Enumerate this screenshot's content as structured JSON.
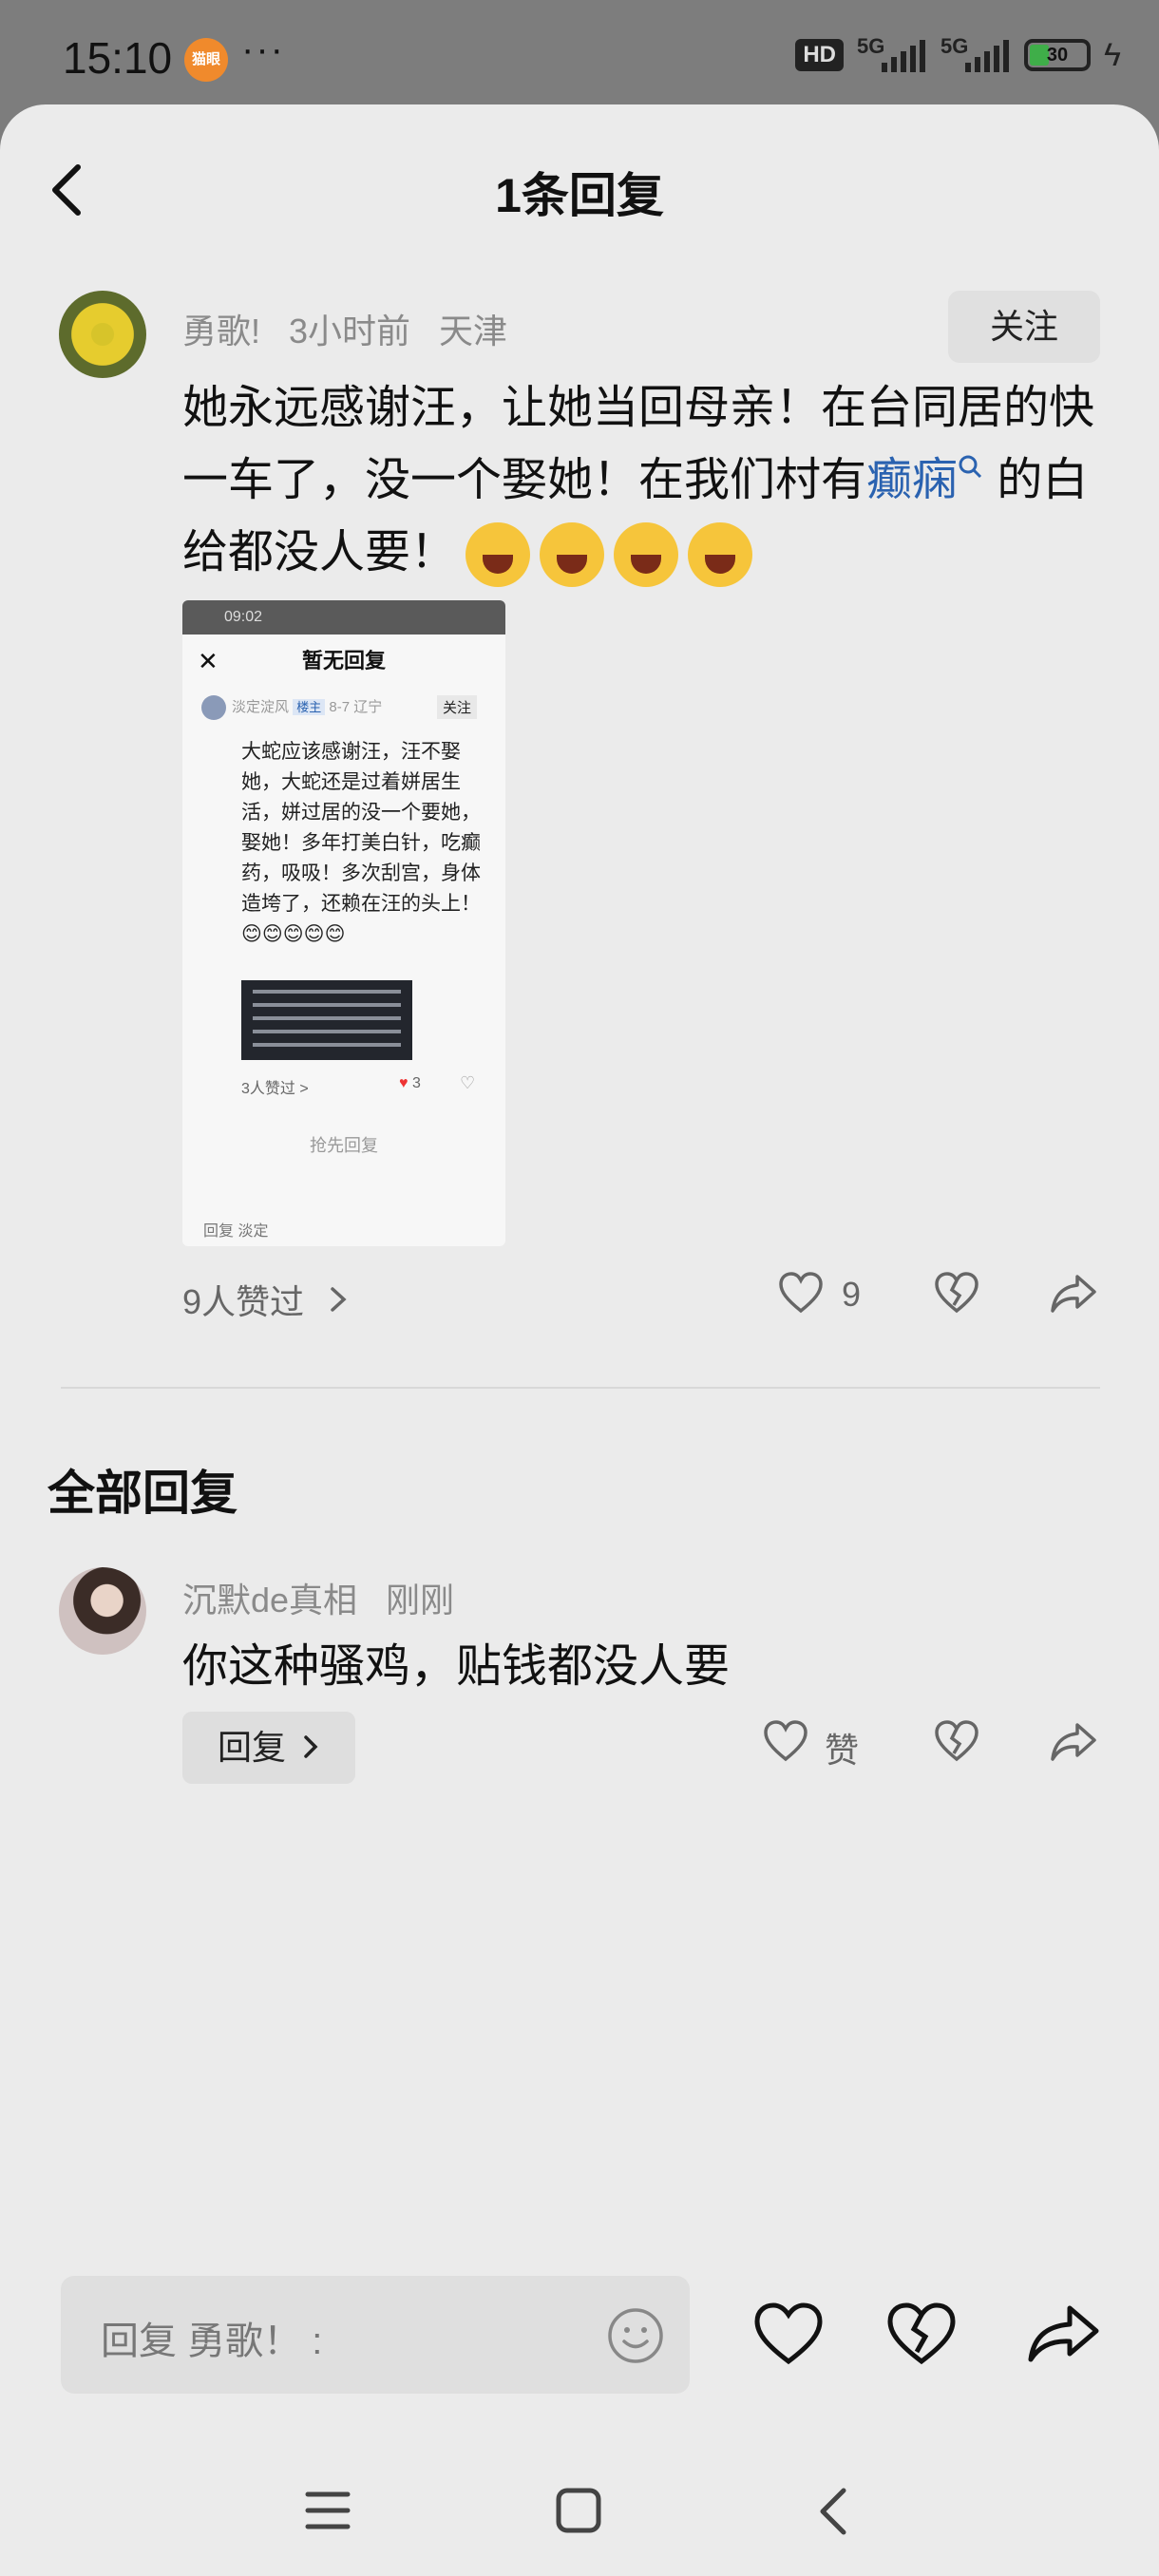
{
  "status_bar": {
    "time": "15:10",
    "app_badge": "猫眼",
    "dots": "···",
    "hd": "HD",
    "net1": "5G",
    "net2": "5G",
    "battery": "30"
  },
  "header": {
    "title": "1条回复"
  },
  "main_comment": {
    "author": "勇歌!",
    "time": "3小时前",
    "location": "天津",
    "follow_label": "关注",
    "text_before_link": "她永远感谢汪，让她当回母亲！在台同居的快一车了，没一个娶她！在我们村有",
    "link_text": "癫痫",
    "text_after_link": "的白给都没人要！",
    "likes_link": "9人赞过",
    "like_count": "9"
  },
  "thumbnail": {
    "status_time": "09:02",
    "title": "暂无回复",
    "close": "✕",
    "user": "淡定淀风",
    "badge": "楼主",
    "date": "8-7",
    "loc": "辽宁",
    "follow": "关注",
    "text": "大蛇应该感谢汪，汪不娶她，大蛇还是过着姘居生活，姘过居的没一个要她，娶她！多年打美白针，吃癫药，吸吸！多次刮宫，身体造垮了，还赖在汪的头上！😊😊😊😊😊",
    "likes": "3人赞过 >",
    "heart_count": "3",
    "first_reply": "抢先回复",
    "bottom_input": "回复 淡定"
  },
  "section": {
    "title": "全部回复"
  },
  "reply": {
    "author": "沉默de真相",
    "time": "刚刚",
    "text": "你这种骚鸡，贴钱都没人要",
    "reply_button": "回复",
    "like_label": "赞"
  },
  "input_bar": {
    "placeholder": "回复 勇歌！ :"
  },
  "colors": {
    "link": "#2a62b0",
    "background": "#ebebeb"
  }
}
